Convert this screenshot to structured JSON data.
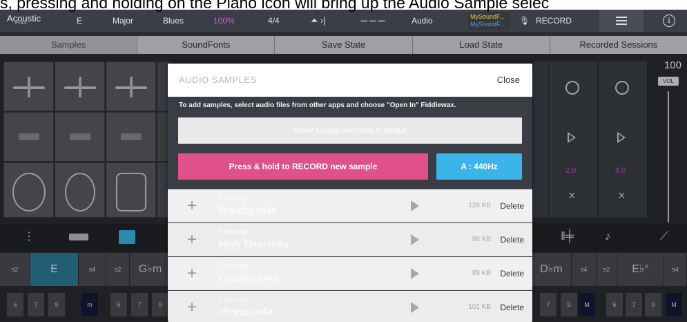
{
  "caption": "s, pressing and holding on the Piano icon will bring up the Audio Sample selec",
  "topbar": {
    "instrument": "Acoustic",
    "instrument_sub": "FULL",
    "key": "E",
    "scale": "Major",
    "style": "Blues",
    "tempo": "100%",
    "time_sig": "4/4",
    "audio_label": "Audio",
    "soundfont_1": "MySoundF...",
    "soundfont_2": "MySoundF...",
    "record_label": "RECORD",
    "info_glyph": "i"
  },
  "tabs": [
    "Samples",
    "SoundFonts",
    "Save State",
    "Load State",
    "Recorded Sessions"
  ],
  "volume": {
    "value": "100",
    "label": "VOL"
  },
  "side_values": {
    "left": "2.0",
    "right": "6.0",
    "close_glyph": "×"
  },
  "chords": {
    "left_sel": "E",
    "left_s2": "s2",
    "left_s4": "s4",
    "mid_s2": "s2",
    "mid_chord": "G♭m",
    "right_chord": "D♭m",
    "right_s4": "s4",
    "right_s2": "s2",
    "right_chord2": "E♭°",
    "right_s4b": "s4",
    "nums_left": [
      "6",
      "7",
      "9",
      "m",
      "6",
      "7",
      "9"
    ],
    "nums_right": [
      "7",
      "9",
      "M",
      "6",
      "7",
      "9",
      "M"
    ]
  },
  "modal": {
    "title": "AUDIO SAMPLES",
    "close_label": "Close",
    "instructions": "To add samples, select audio files from other apps and choose \"Open In\" Fiddlewax.",
    "reset_label": "Reset sample overrides to default",
    "record_label": "Press & hold to RECORD new sample",
    "tune_label": "A : 440Hz",
    "samples": [
      {
        "when": "5 days ago",
        "name": "Breathy.m4a",
        "size": "129 KB",
        "delete": "Delete"
      },
      {
        "when": "6 days ago",
        "name": "High Time.m4a",
        "size": "98 KB",
        "delete": "Delete"
      },
      {
        "when": "7 days ago",
        "name": "Counter.m4a",
        "size": "89 KB",
        "delete": "Delete"
      },
      {
        "when": "7 days ago",
        "name": "chorus.m4a",
        "size": "101 KB",
        "delete": "Delete"
      }
    ]
  },
  "colors": {
    "record_pink": "#e0508a",
    "tune_blue": "#3cb4ea",
    "accent_magenta": "#d84fe0",
    "selected_teal": "#2e7e9a"
  }
}
